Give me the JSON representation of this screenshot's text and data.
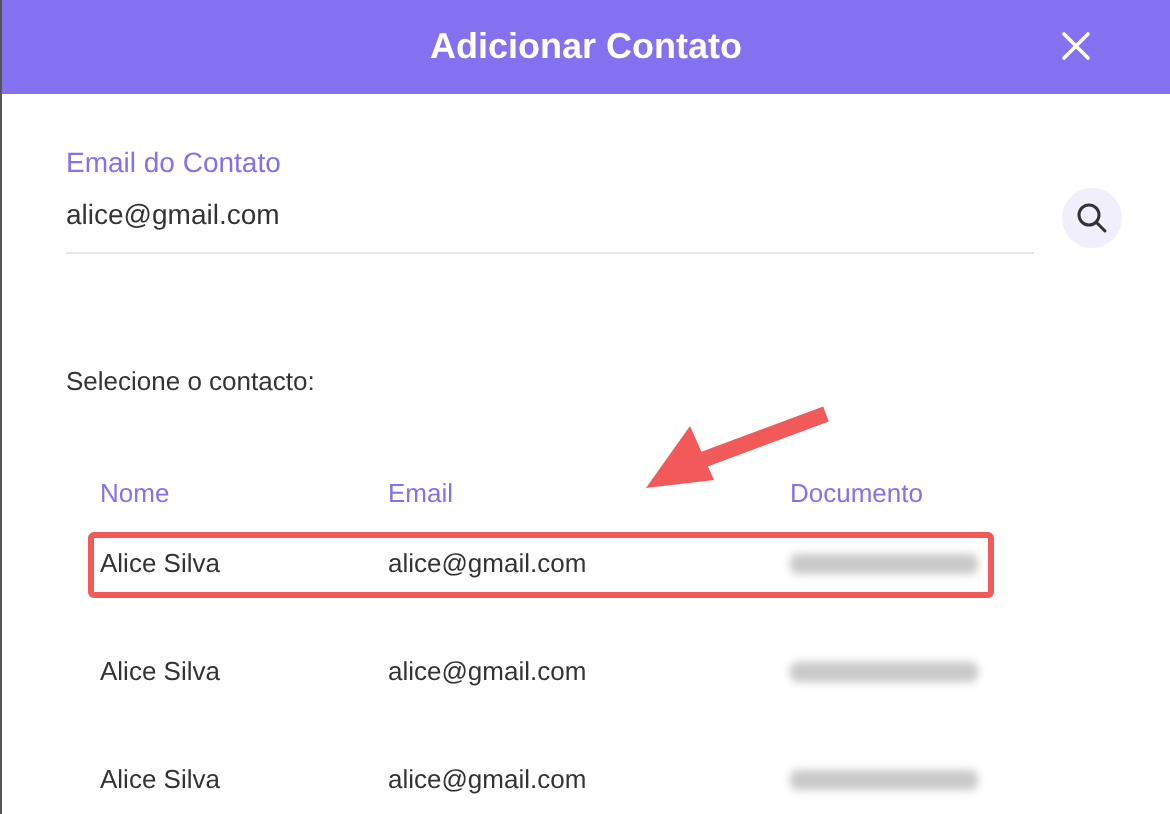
{
  "dialog": {
    "title": "Adicionar Contato"
  },
  "email_field": {
    "label": "Email do Contato",
    "value": "alice@gmail.com"
  },
  "prompt": "Selecione o contacto:",
  "table": {
    "columns": [
      "Nome",
      "Email",
      "Documento"
    ],
    "rows": [
      {
        "name": "Alice Silva",
        "email": "alice@gmail.com",
        "selected": true
      },
      {
        "name": "Alice Silva",
        "email": "alice@gmail.com",
        "selected": false
      },
      {
        "name": "Alice Silva",
        "email": "alice@gmail.com",
        "selected": false
      }
    ]
  }
}
